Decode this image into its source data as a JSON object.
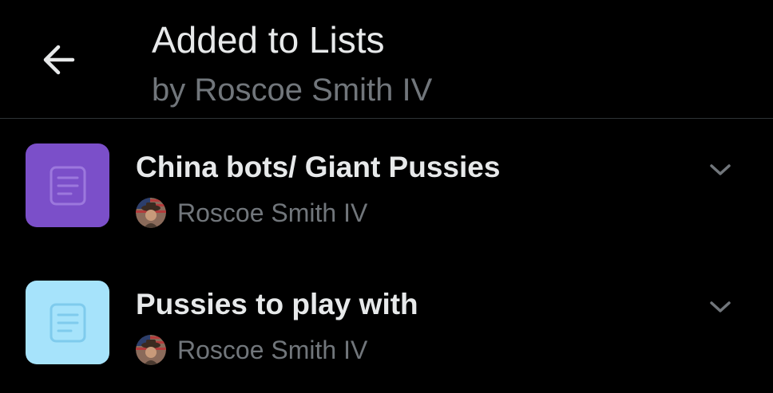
{
  "header": {
    "back_icon": "arrow-left-icon",
    "title": "Added to Lists",
    "subtitle": "by Roscoe Smith IV"
  },
  "colors": {
    "background": "#000000",
    "primary_text": "#e7e9ea",
    "secondary_text": "#71767b",
    "divider": "#2f3336"
  },
  "lists": [
    {
      "name": "China bots/ Giant Pussies",
      "owner": "Roscoe Smith IV",
      "icon": "list-document-icon",
      "icon_bg": "#7b4fc9",
      "icon_fg": "#9c78dd",
      "menu_icon": "chevron-down-icon"
    },
    {
      "name": "Pussies to play with",
      "owner": "Roscoe Smith IV",
      "icon": "list-document-icon",
      "icon_bg": "#a6e3fb",
      "icon_fg": "#7fcbed",
      "menu_icon": "chevron-down-icon"
    }
  ]
}
